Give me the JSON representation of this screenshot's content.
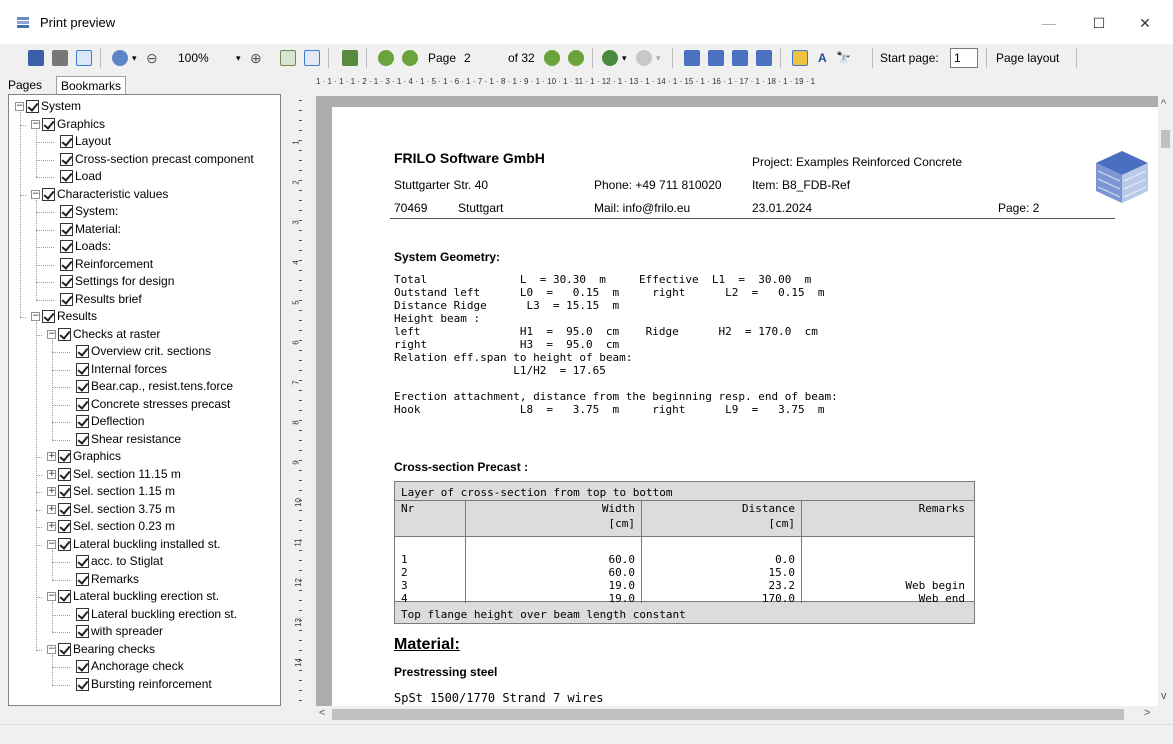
{
  "window": {
    "title": "Print preview",
    "minimize": "—",
    "maximize": "☐",
    "close": "✕"
  },
  "toolbar": {
    "zoom": "100%",
    "page_label": "Page",
    "page_value": "2",
    "of_label": "of 32",
    "start_page_label": "Start page:",
    "start_page_value": "1",
    "page_layout_label": "Page layout"
  },
  "tabs": [
    "Pages",
    "Bookmarks"
  ],
  "tree": [
    {
      "label": "System",
      "level": 0,
      "exp": "−"
    },
    {
      "label": "Graphics",
      "level": 1,
      "exp": "−"
    },
    {
      "label": "Layout",
      "level": 2
    },
    {
      "label": "Cross-section precast component",
      "level": 2
    },
    {
      "label": "Load",
      "level": 2
    },
    {
      "label": "Characteristic values",
      "level": 1,
      "exp": "−"
    },
    {
      "label": "System:",
      "level": 2
    },
    {
      "label": "Material:",
      "level": 2
    },
    {
      "label": "Loads:",
      "level": 2
    },
    {
      "label": "Reinforcement",
      "level": 2
    },
    {
      "label": "Settings for design",
      "level": 2
    },
    {
      "label": "Results brief",
      "level": 2
    },
    {
      "label": "Results",
      "level": 1,
      "exp": "−"
    },
    {
      "label": "Checks at raster",
      "level": 2,
      "exp": "−"
    },
    {
      "label": "Overview crit. sections",
      "level": 3
    },
    {
      "label": "Internal forces",
      "level": 3
    },
    {
      "label": "Bear.cap., resist.tens.force",
      "level": 3
    },
    {
      "label": "Concrete stresses precast",
      "level": 3
    },
    {
      "label": "Deflection",
      "level": 3
    },
    {
      "label": "Shear resistance",
      "level": 3
    },
    {
      "label": "Graphics",
      "level": 2,
      "exp": "+"
    },
    {
      "label": "Sel. section  11.15 m",
      "level": 2,
      "exp": "+"
    },
    {
      "label": "Sel. section  1.15 m",
      "level": 2,
      "exp": "+"
    },
    {
      "label": "Sel. section  3.75 m",
      "level": 2,
      "exp": "+"
    },
    {
      "label": "Sel. section  0.23 m",
      "level": 2,
      "exp": "+"
    },
    {
      "label": "Lateral buckling installed st.",
      "level": 2,
      "exp": "−"
    },
    {
      "label": "acc. to Stiglat",
      "level": 3
    },
    {
      "label": "Remarks",
      "level": 3
    },
    {
      "label": "Lateral buckling erection st.",
      "level": 2,
      "exp": "−"
    },
    {
      "label": "Lateral buckling erection st.",
      "level": 3
    },
    {
      "label": "with spreader",
      "level": 3
    },
    {
      "label": "Bearing checks",
      "level": 2,
      "exp": "−"
    },
    {
      "label": "Anchorage check",
      "level": 3
    },
    {
      "label": "Bursting reinforcement",
      "level": 3
    }
  ],
  "ruler": {
    "h": "1 · 1 · 1 · 1 · 2 · 1 · 3 · 1 · 4 · 1 · 5 · 1 · 6 · 1 · 7 · 1 · 8 · 1 · 9 · 1 · 10 · 1 · 11 · 1 · 12 · 1 · 13 · 1 · 14 · 1 · 15 · 1 · 16 · 1 · 17 · 1 · 18 · 1 · 19 · 1",
    "v": [
      "1",
      "2",
      "3",
      "4",
      "5",
      "6",
      "7",
      "8",
      "9",
      "10",
      "11",
      "12",
      "13",
      "14"
    ]
  },
  "doc": {
    "company": "FRILO Software GmbH",
    "street": "Stuttgarter Str. 40",
    "zip": "70469",
    "city": "Stuttgart",
    "phone": "Phone: +49 711 810020",
    "mail": "Mail: info@frilo.eu",
    "project": "Project: Examples Reinforced Concrete",
    "item": "Item: B8_FDB-Ref",
    "date": "23.01.2024",
    "page": "Page: 2",
    "sys_geo_title": "System Geometry:",
    "geo_lines": [
      "Total              L  = 30.30  m     Effective  L1  =  30.00  m",
      "Outstand left      L0  =   0.15  m     right      L2  =   0.15  m",
      "Distance Ridge      L3  = 15.15  m",
      "Height beam :",
      "left               H1  =  95.0  cm    Ridge      H2  = 170.0  cm",
      "right              H3  =  95.0  cm",
      "Relation eff.span to height of beam:",
      "                  L1/H2  = 17.65",
      "",
      "Erection attachment, distance from the beginning resp. end of beam:",
      "Hook               L8  =   3.75  m     right      L9  =   3.75  m"
    ],
    "cross_title": "Cross-section Precast :",
    "table_caption": "Layer of cross-section from top to bottom",
    "table_headers": [
      "Nr",
      "Width",
      "Distance",
      "Remarks"
    ],
    "table_units": [
      "",
      "[cm]",
      "[cm]",
      ""
    ],
    "table_rows": [
      [
        "1",
        "60.0",
        "0.0",
        ""
      ],
      [
        "2",
        "60.0",
        "15.0",
        ""
      ],
      [
        "3",
        "19.0",
        "23.2",
        "Web begin"
      ],
      [
        "4",
        "19.0",
        "170.0",
        "Web end"
      ]
    ],
    "table_footer": "Top flange height over beam length constant",
    "material_title": "Material:",
    "prestress_title": "Prestressing steel",
    "prestress_line": "SpSt 1500/1770 Strand 7 wires"
  }
}
